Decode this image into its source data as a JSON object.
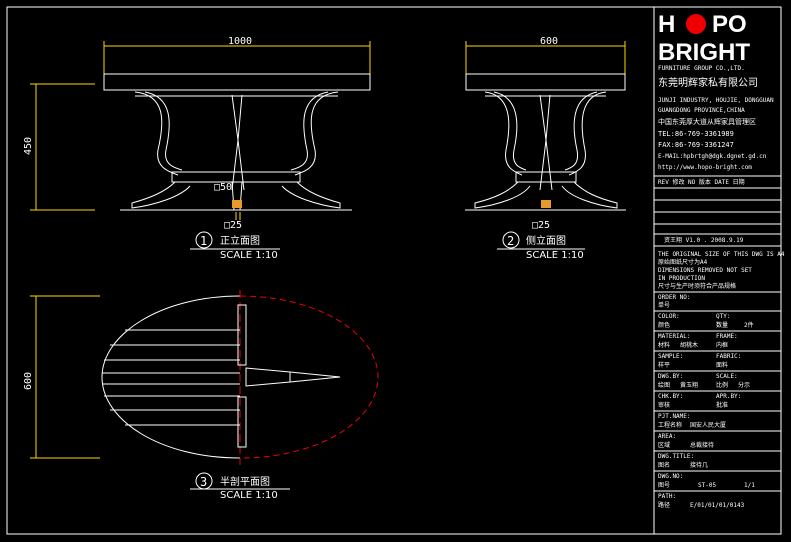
{
  "drawing": {
    "views": [
      {
        "number": "1",
        "title": "正立面图",
        "scale": "SCALE 1:10"
      },
      {
        "number": "2",
        "title": "侧立面图",
        "scale": "SCALE 1:10"
      },
      {
        "number": "3",
        "title": "半剖平面图",
        "scale": "SCALE 1:10"
      }
    ],
    "dims": {
      "front_width": "1000",
      "side_width": "600",
      "height": "450",
      "plan_depth": "600",
      "post_size": "□50",
      "foot_size": "□25",
      "foot_size_side": "□25"
    }
  },
  "title_block": {
    "logo_word1_a": "H",
    "logo_word1_b": "PO",
    "logo_word2": "BRIGHT",
    "company_en": "FURNITURE GROUP CO.,LTD.",
    "company_cn": "东莞明辉家私有限公司",
    "addr1": "JUNJI INDUSTRY, HOUJIE, DONGGUAN",
    "addr2": "GUANGDONG PROVINCE,CHINA",
    "addr_cn": "中国东莞厚大道从辉家具管理区",
    "tel": "TEL:86-769-3361989",
    "fax": "FAX:86-769-3361247",
    "email": "E-MAIL:hpbrtgh@dgk.dgnet.gd.cn",
    "web": "http://www.hopo-bright.com",
    "rev_header": "REV 修改   NO 版本   DATE 日期",
    "designer_line": "资王翔    V1.0  .  2008.9.19",
    "note1": "THE ORIGINAL SIZE OF THIS DWG IS A4",
    "note2": "原始图纸尺寸为A4",
    "note3": "DIMENSIONS REMOVED NOT SET",
    "note4": "IN PRODUCTION",
    "note5": "尺寸与生产时须符合产品规格",
    "order_label": "ORDER NO:",
    "order_cn": "单号",
    "color_label": "COLOR:",
    "color_cn": "颜色",
    "qty_label": "QTY:",
    "qty_cn": "数量",
    "qty_val": "2件",
    "material_label": "MATERIAL:",
    "material_cn": "材料",
    "material_val": "胡桃木",
    "frame_label": "FRAME:",
    "frame_val": "内框",
    "sample_label": "SAMPLE:",
    "sample_cn": "样平",
    "fabric_label": "FABRIC:",
    "fabric_cn": "面料",
    "drawn_label": "DWG.BY:",
    "drawn_cn": "绘图",
    "drawn_val": "黄玉翔",
    "scale_label": "SCALE:",
    "scale_cn": "比例",
    "scale_val": "分示",
    "chk_label": "CHK.BY:",
    "chk_cn": "审核",
    "apr_label": "APR.BY:",
    "apr_cn": "批准",
    "prj_label": "PJT.NAME:",
    "prj_cn": "工程名称",
    "prj_val": "国安人民大厦",
    "area_label": "AREA:",
    "area_cn": "区域",
    "area_val": "总裁接待",
    "dwg_title_label": "DWG.TITLE:",
    "dwg_title_cn": "图名",
    "dwg_title_val": "接待几",
    "dwg_no_label": "DWG.NO:",
    "dwg_no_cn": "图号",
    "dwg_no_val": "ST-05",
    "sheet_val": "1/1",
    "path_label": "PATH:",
    "path_cn": "路径",
    "path_val": "E/01/01/01/0143"
  }
}
